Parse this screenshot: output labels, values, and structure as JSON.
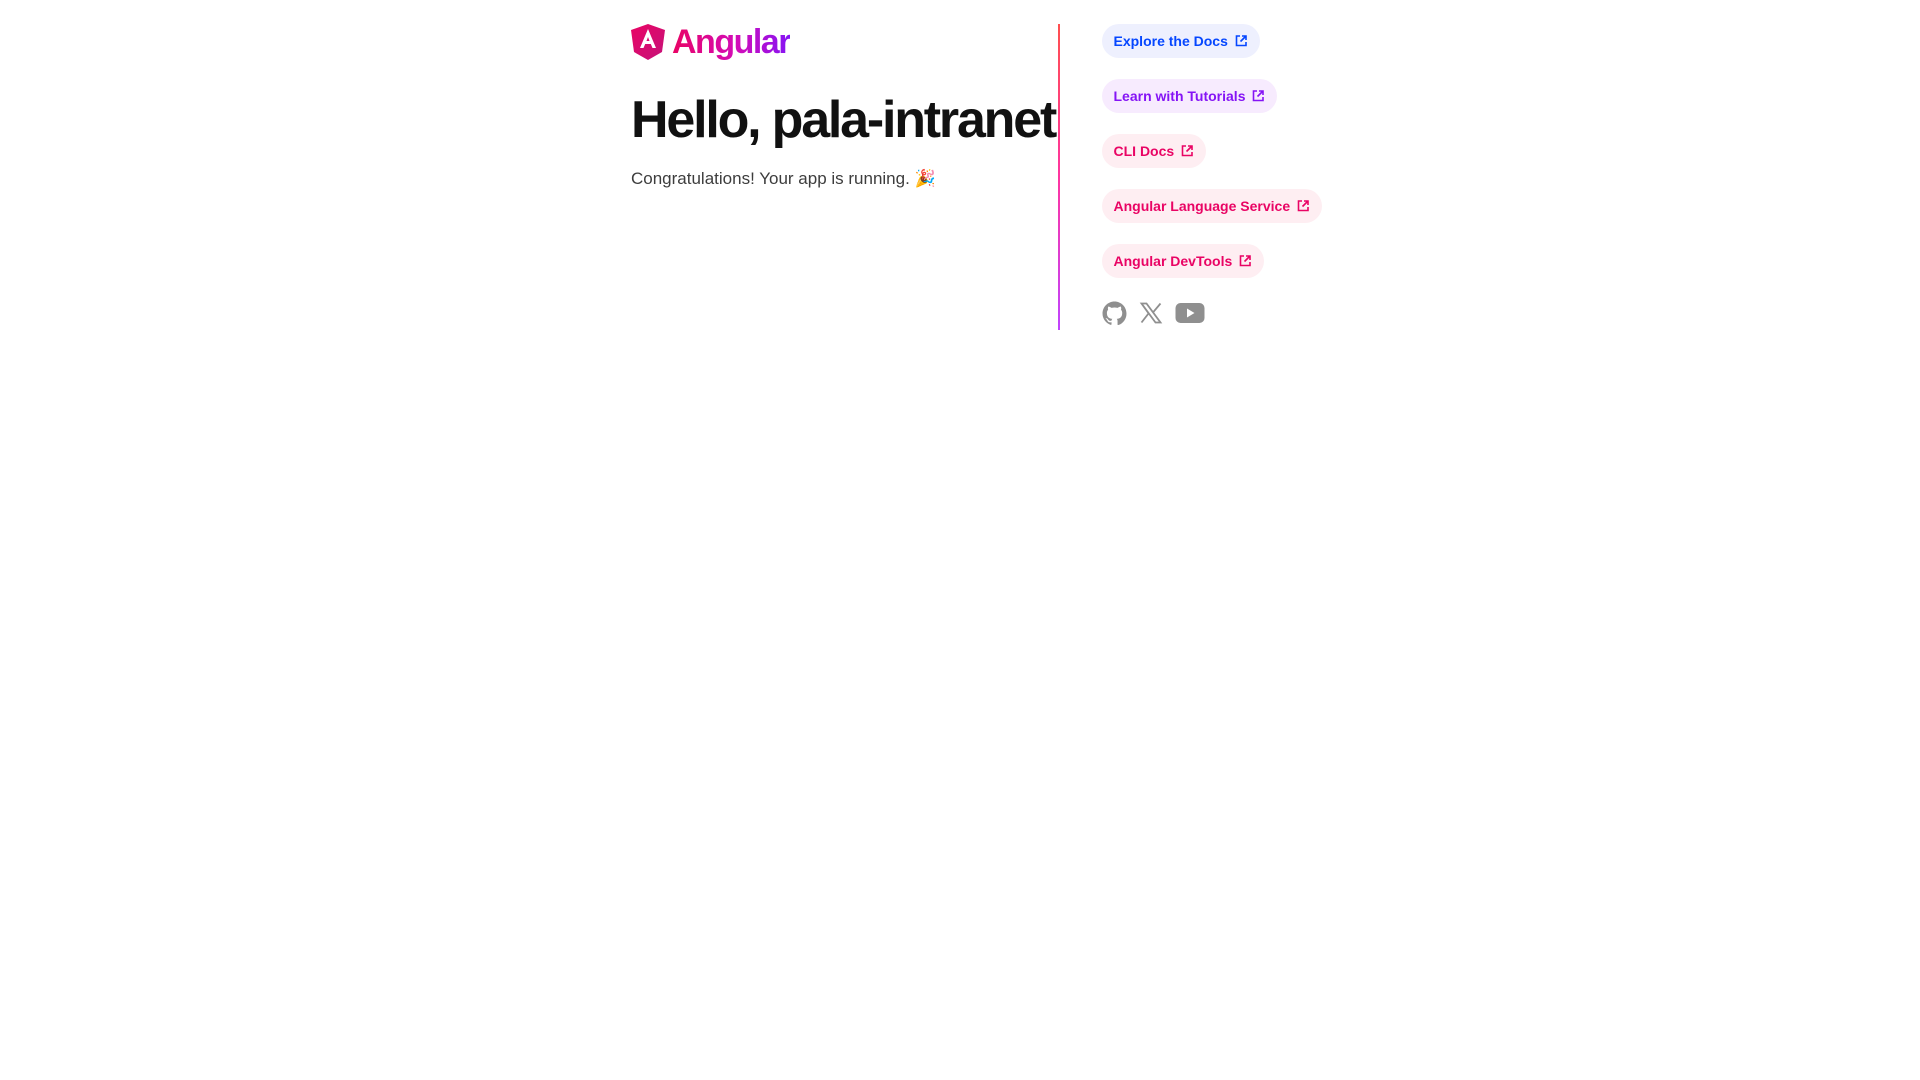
{
  "logo": {
    "name": "Angular",
    "icon": "angular-logo-icon",
    "gradient": [
      "#e90464",
      "#d30cb8",
      "#8514f5"
    ]
  },
  "main": {
    "title": "Hello, pala-intranet",
    "subtitle": "Congratulations! Your app is running. 🎉"
  },
  "links": [
    {
      "label": "Explore the Docs",
      "icon": "external-link-icon",
      "color": "#0546ff",
      "bg": "#eef0fe"
    },
    {
      "label": "Learn with Tutorials",
      "icon": "external-link-icon",
      "color": "#8514f5",
      "bg": "#f7ebfe"
    },
    {
      "label": "CLI Docs",
      "icon": "external-link-icon",
      "color": "#e90464",
      "bg": "#feeef2"
    },
    {
      "label": "Angular Language Service",
      "icon": "external-link-icon",
      "color": "#e90464",
      "bg": "#feeef2"
    },
    {
      "label": "Angular DevTools",
      "icon": "external-link-icon",
      "color": "#e90464",
      "bg": "#feeef2"
    }
  ],
  "social": [
    {
      "icon": "github-icon"
    },
    {
      "icon": "x-twitter-icon"
    },
    {
      "icon": "youtube-icon"
    }
  ],
  "colors": {
    "divider_gradient": [
      "#ff4f4f",
      "#ff35a0",
      "#c044ff"
    ],
    "social_icon": "#8f8f8f",
    "title": "#111111",
    "subtitle": "#3d3d3d"
  }
}
